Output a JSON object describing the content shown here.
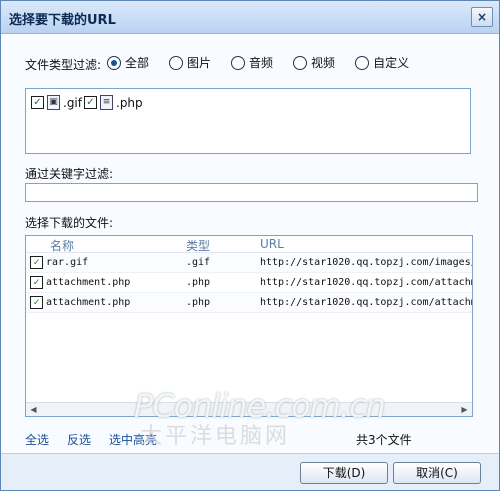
{
  "dialog": {
    "title": "选择要下载的URL",
    "close": "×"
  },
  "filter": {
    "label": "文件类型过滤:",
    "options": [
      "全部",
      "图片",
      "音频",
      "视频",
      "自定义"
    ],
    "selected": "全部"
  },
  "extensions": [
    {
      "label": ".gif",
      "checked": true
    },
    {
      "label": ".php",
      "checked": true
    }
  ],
  "keyword": {
    "label": "通过关键字过滤:",
    "value": ""
  },
  "files": {
    "label": "选择下载的文件:",
    "columns": [
      "名称",
      "类型",
      "URL"
    ],
    "rows": [
      {
        "name": "rar.gif",
        "type": ".gif",
        "url": "http://star1020.qq.topzj.com/images/at",
        "checked": true
      },
      {
        "name": "attachment.php",
        "type": ".php",
        "url": "http://star1020.qq.topzj.com/attachmen",
        "checked": true
      },
      {
        "name": "attachment.php",
        "type": ".php",
        "url": "http://star1020.qq.topzj.com/attachmen",
        "checked": true
      }
    ]
  },
  "links": {
    "select_all": "全选",
    "invert": "反选",
    "highlight": "选中高亮"
  },
  "total": "共3个文件",
  "buttons": {
    "download": "下载(D)",
    "cancel": "取消(C)"
  },
  "watermark": {
    "line1": "PConline.com.cn",
    "line2": "太平洋电脑网"
  }
}
